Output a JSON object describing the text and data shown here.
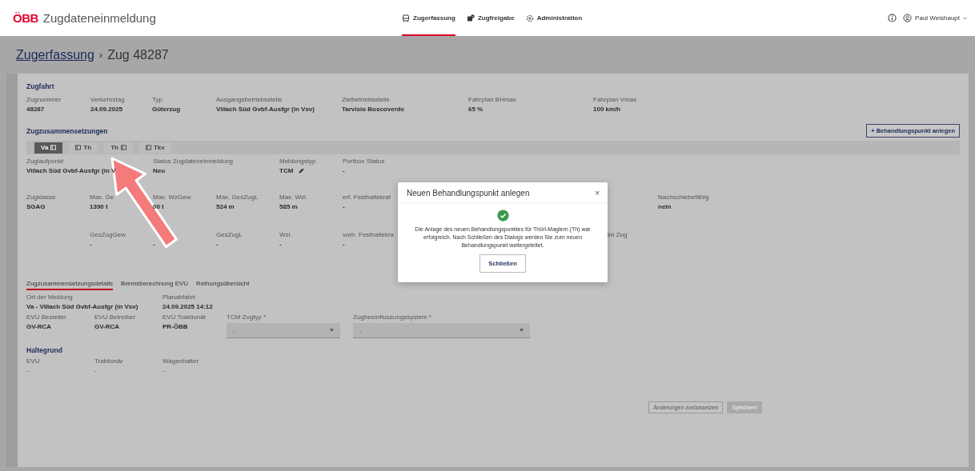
{
  "header": {
    "logo": "ÖBB",
    "app_title": "Zugdateneinmeldung",
    "nav": [
      {
        "label": "Zugerfassung",
        "selected": true
      },
      {
        "label": "Zugfreigabe",
        "selected": false
      },
      {
        "label": "Administration",
        "selected": false
      }
    ],
    "user": "Paul Weishaupt"
  },
  "breadcrumb": {
    "link": "Zugerfassung",
    "separator": "›",
    "current": "Zug 48287"
  },
  "zugfahrt": {
    "title": "Zugfahrt",
    "fields": [
      {
        "label": "Zugnummer",
        "value": "48287"
      },
      {
        "label": "Verkehrstag",
        "value": "24.09.2025"
      },
      {
        "label": "Typ",
        "value": "Güterzug"
      },
      {
        "label": "Ausgangsbetriebsstelle",
        "value": "Villach Süd Gvbf-Ausfgr (in Vsv)"
      },
      {
        "label": "Zielbetriebsstelle",
        "value": "Tarvisio Boscoverde"
      },
      {
        "label": "Fahrplan BHmax",
        "value": "65 %"
      },
      {
        "label": "Fahrplan Vmax",
        "value": "100 km/h"
      }
    ]
  },
  "composition": {
    "title": "Zugzusammensetzungen",
    "add_button": "+ Behandlungspunkt anlegen",
    "tabs": [
      {
        "label": "Va",
        "kind": "icon_after",
        "selected": true
      },
      {
        "label": "Th",
        "kind": "icon_before",
        "selected": false
      },
      {
        "label": "Th",
        "kind": "icon_after",
        "selected": false
      },
      {
        "label": "Tkv",
        "kind": "icon_before",
        "selected": false
      }
    ],
    "rows": [
      [
        {
          "label": "Zuglaufpunkt",
          "value": "Villach Süd Gvbf-Ausfgr (in V"
        },
        "",
        {
          "label": "Status Zugdateneinmeldung",
          "value": "Neu"
        },
        "",
        {
          "label": "Meldungstyp",
          "value": "TCM",
          "editable": true
        },
        {
          "label": "Portbox Status",
          "value": "-"
        }
      ],
      [
        {
          "label": "Zugklasse",
          "value": "SGAG"
        },
        {
          "label": "Max. Ge",
          "value": "1390 t"
        },
        {
          "label": "Max. WzGew",
          "value": "00 t"
        },
        {
          "label": "Max. GesZugL",
          "value": "524 m"
        },
        {
          "label": "Max. Wzl.",
          "value": "585 m"
        },
        {
          "label": "erf. Festhaltekraf",
          "value": "-"
        }
      ],
      [
        "",
        {
          "label": "GesZugGew",
          "value": "-"
        },
        {
          "value": "-"
        },
        {
          "label": "GesZugL",
          "value": "-"
        },
        {
          "label": "Wzl.",
          "value": "-"
        },
        {
          "label": "vorh. Festhaltekra",
          "value": "-"
        }
      ]
    ],
    "beside_dialog": [
      {
        "label": "Nachschiebefähig",
        "value": "nein"
      },
      {
        "label": "im Zug"
      }
    ]
  },
  "detail_tabs": [
    {
      "label": "Zugzusammensetzungsdetails",
      "selected": true
    },
    {
      "label": "Bremsberechnung EVU",
      "selected": false
    },
    {
      "label": "Reihungsübersicht",
      "selected": false
    }
  ],
  "details": {
    "rows": [
      [
        {
          "label": "Ort der Meldung",
          "value": "Va - Villach Süd Gvbf-Ausfgr (in Vsv)"
        },
        "",
        {
          "label": "Planabfahrt",
          "value": "24.09.2025 14:12"
        }
      ],
      [
        {
          "label": "EVU Besteller",
          "value": "GV-RCA"
        },
        {
          "label": "EVU Betreiber",
          "value": "GV-RCA"
        },
        {
          "label": "EVU Traktionär",
          "value": "PR-ÖBB"
        },
        {
          "label": "TCM Zugtyp *",
          "placeholder": "-"
        },
        {
          "label": "Zugbeeinflussungssystem *",
          "placeholder": "-"
        }
      ]
    ]
  },
  "haltegrund": {
    "title": "Haltegrund",
    "fields": [
      {
        "label": "EVU",
        "value": "-"
      },
      {
        "label": "Traktionär",
        "value": "-"
      },
      {
        "label": "Wagenhalter",
        "value": "-"
      }
    ]
  },
  "actions": [
    {
      "label": "Änderungen zurücksetzen",
      "disabled": false
    },
    {
      "label": "Speichern",
      "disabled": true
    }
  ],
  "dialog": {
    "title": "Neuen Behandlungspunkt anlegen",
    "close": "×",
    "message": "Die Anlage des neuen Behandlungspunktes für Thörl-Maglern (Th) war erfolgreich. Nach Schließen des Dialogs werden Sie zum neuen Behandlungspunkt weitergeleitet.",
    "button": "Schließen"
  }
}
